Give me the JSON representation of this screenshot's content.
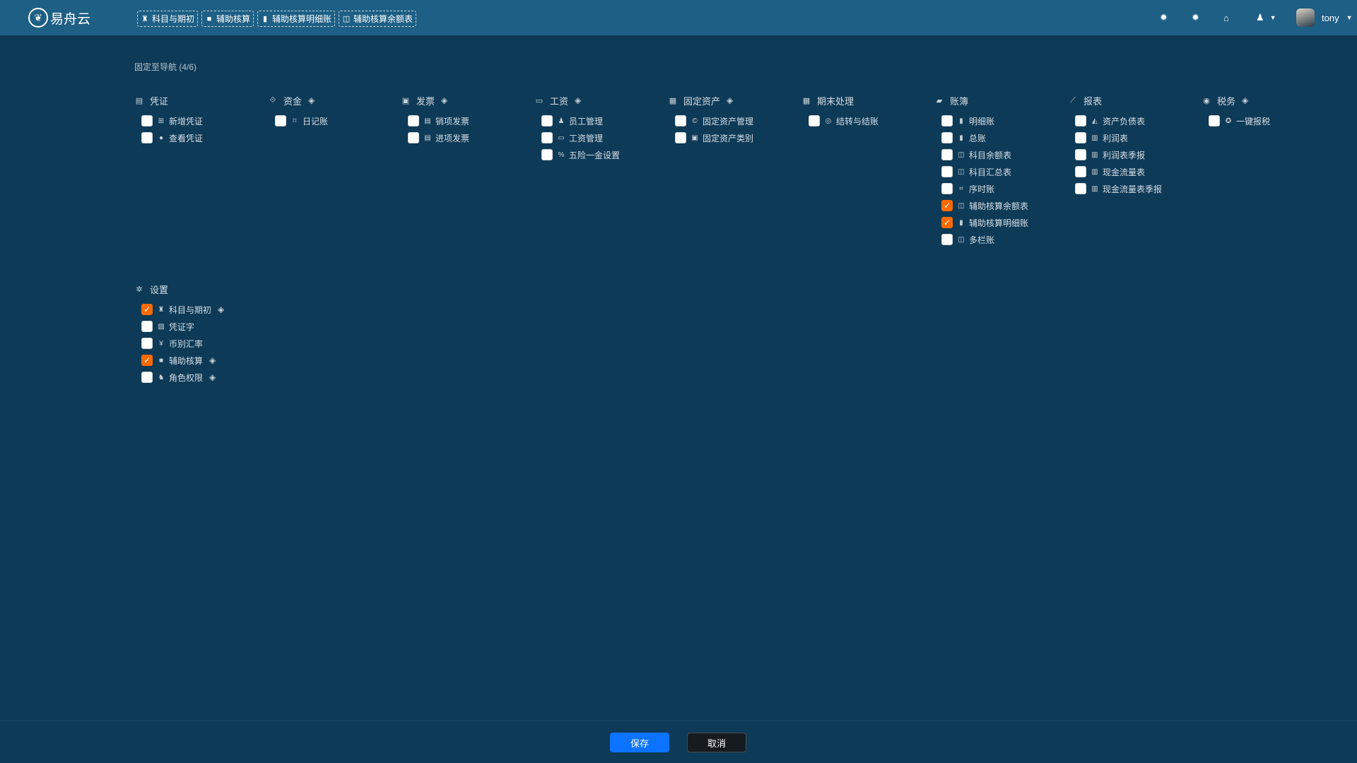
{
  "app": {
    "name": "易舟云"
  },
  "quick_nav": [
    {
      "label": "科目与期初",
      "icon": "sitemap-icon"
    },
    {
      "label": "辅助核算",
      "icon": "folder-icon"
    },
    {
      "label": "辅助核算明细账",
      "icon": "bookmark-icon"
    },
    {
      "label": "辅助核算余额表",
      "icon": "columns-icon"
    }
  ],
  "topbar": {
    "username": "tony",
    "icons": [
      "bug-icon",
      "bug-icon",
      "home-icon",
      "user-menu-icon"
    ]
  },
  "pin_title": "固定至导航 (4/6)",
  "groups": [
    {
      "id": "voucher",
      "title": "凭证",
      "icon": "id-card-icon",
      "premium": false,
      "items": [
        {
          "label": "新增凭证",
          "icon": "plus-square-icon",
          "checked": false
        },
        {
          "label": "查看凭证",
          "icon": "check-circle-icon",
          "checked": false
        }
      ]
    },
    {
      "id": "funds",
      "title": "资金",
      "icon": "exchange-icon",
      "premium": true,
      "items": [
        {
          "label": "日记账",
          "icon": "bookmark-outline-icon",
          "checked": false
        }
      ]
    },
    {
      "id": "invoice",
      "title": "发票",
      "icon": "image-icon",
      "premium": true,
      "items": [
        {
          "label": "销项发票",
          "icon": "id-card-icon",
          "checked": false
        },
        {
          "label": "进项发票",
          "icon": "id-card-icon",
          "checked": false
        }
      ]
    },
    {
      "id": "salary",
      "title": "工资",
      "icon": "credit-card-icon",
      "premium": true,
      "items": [
        {
          "label": "员工管理",
          "icon": "user-icon",
          "checked": false
        },
        {
          "label": "工资管理",
          "icon": "credit-card-icon",
          "checked": false
        },
        {
          "label": "五险一金设置",
          "icon": "percent-icon",
          "checked": false
        }
      ]
    },
    {
      "id": "assets",
      "title": "固定资产",
      "icon": "building-icon",
      "premium": true,
      "items": [
        {
          "label": "固定资产管理",
          "icon": "copyright-icon",
          "checked": false
        },
        {
          "label": "固定资产类别",
          "icon": "image-icon",
          "checked": false
        }
      ]
    },
    {
      "id": "period_end",
      "title": "期末处理",
      "icon": "calendar-icon",
      "premium": false,
      "items": [
        {
          "label": "结转与结账",
          "icon": "target-icon",
          "checked": false
        }
      ]
    },
    {
      "id": "ledger",
      "title": "账簿",
      "icon": "book-icon",
      "premium": false,
      "items": [
        {
          "label": "明细账",
          "icon": "bookmark-icon",
          "checked": false
        },
        {
          "label": "总账",
          "icon": "bookmark-icon",
          "checked": false
        },
        {
          "label": "科目余额表",
          "icon": "columns-icon",
          "checked": false
        },
        {
          "label": "科目汇总表",
          "icon": "columns-icon",
          "checked": false
        },
        {
          "label": "序时账",
          "icon": "crop-icon",
          "checked": false
        },
        {
          "label": "辅助核算余额表",
          "icon": "columns-icon",
          "checked": true
        },
        {
          "label": "辅助核算明细账",
          "icon": "bookmark-icon",
          "checked": true
        },
        {
          "label": "多栏账",
          "icon": "columns-icon",
          "checked": false
        }
      ]
    },
    {
      "id": "reports",
      "title": "报表",
      "icon": "line-chart-icon",
      "premium": false,
      "items": [
        {
          "label": "资产负债表",
          "icon": "area-chart-icon",
          "checked": false
        },
        {
          "label": "利润表",
          "icon": "bar-chart-icon",
          "checked": false
        },
        {
          "label": "利润表季报",
          "icon": "bar-chart-icon",
          "checked": false
        },
        {
          "label": "现金流量表",
          "icon": "bar-chart-icon",
          "checked": false
        },
        {
          "label": "现金流量表季报",
          "icon": "bar-chart-icon",
          "checked": false
        }
      ]
    },
    {
      "id": "tax",
      "title": "税务",
      "icon": "disc-icon",
      "premium": true,
      "items": [
        {
          "label": "一键报税",
          "icon": "rebel-icon",
          "checked": false
        }
      ]
    },
    {
      "id": "settings",
      "title": "设置",
      "icon": "gear-icon",
      "premium": false,
      "items": [
        {
          "label": "科目与期初",
          "icon": "sitemap-icon",
          "checked": true,
          "premium": true
        },
        {
          "label": "凭证字",
          "icon": "wpforms-icon",
          "checked": false,
          "premium": false
        },
        {
          "label": "币别汇率",
          "icon": "yen-icon",
          "checked": false,
          "premium": false
        },
        {
          "label": "辅助核算",
          "icon": "folder-icon",
          "checked": true,
          "premium": true
        },
        {
          "label": "角色权限",
          "icon": "users-icon",
          "checked": false,
          "premium": true
        }
      ]
    }
  ],
  "footer": {
    "save_label": "保存",
    "cancel_label": "取消"
  },
  "colors": {
    "accent": "#0b73ff",
    "checked": "#ff6a00",
    "header": "#1e5f85",
    "background": "#0d3a57"
  }
}
